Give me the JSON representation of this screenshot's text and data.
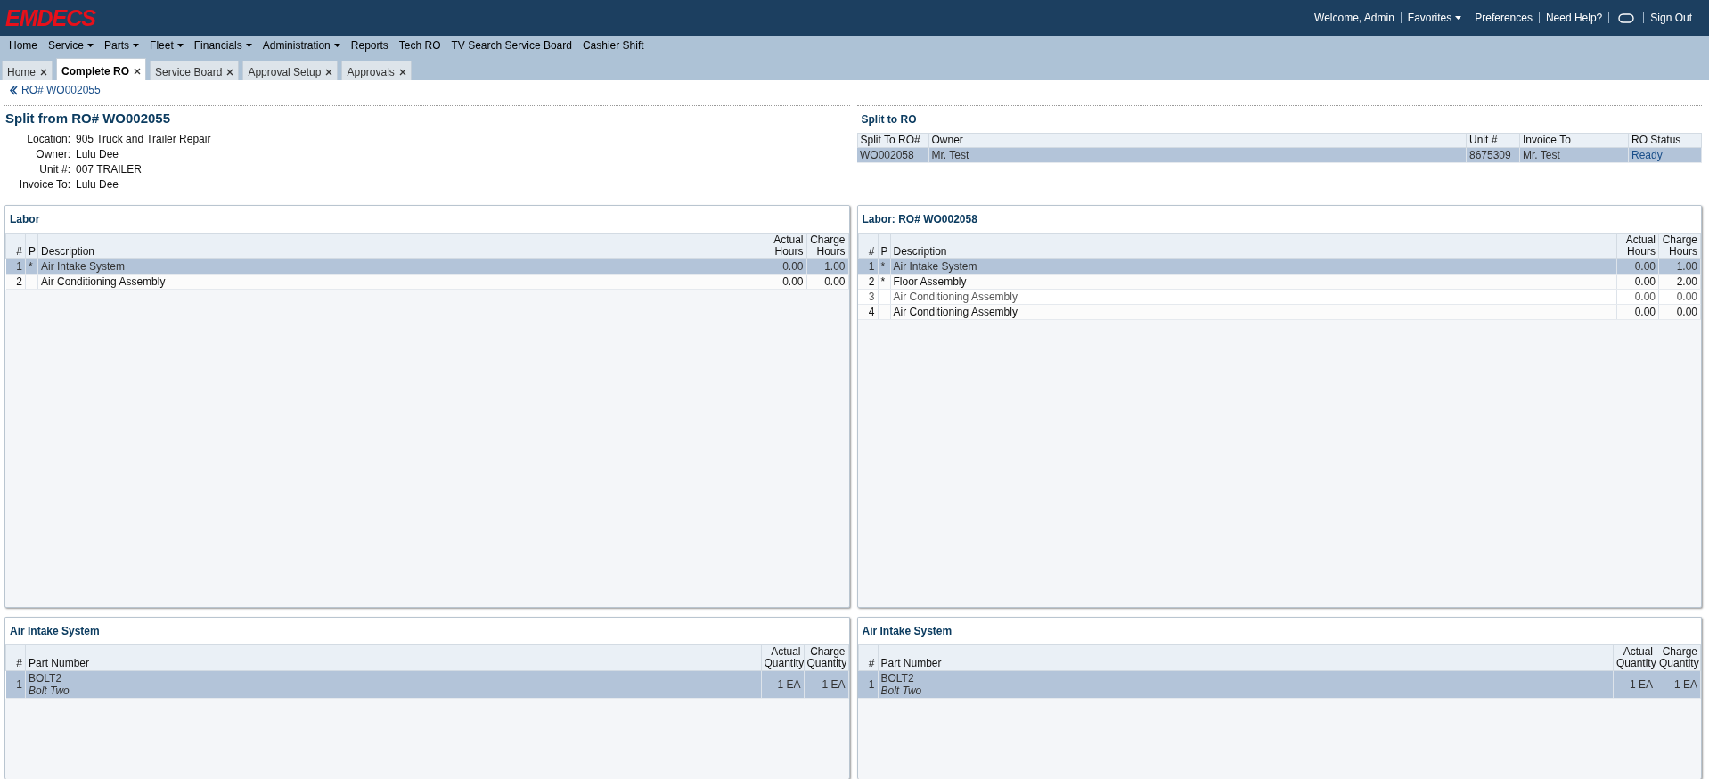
{
  "app_bar": {
    "logo": "EMDECS",
    "user_links": [
      {
        "kind": "text",
        "label": "Welcome, Admin"
      },
      {
        "kind": "menu",
        "label": "Favorites"
      },
      {
        "kind": "link",
        "label": "Preferences"
      },
      {
        "kind": "link",
        "label": "Need Help?"
      },
      {
        "kind": "chat"
      },
      {
        "kind": "link",
        "label": "Sign Out"
      }
    ]
  },
  "nav_menu": [
    {
      "label": "Home",
      "dropdown": false
    },
    {
      "label": "Service",
      "dropdown": true
    },
    {
      "label": "Parts",
      "dropdown": true
    },
    {
      "label": "Fleet",
      "dropdown": true
    },
    {
      "label": "Financials",
      "dropdown": true
    },
    {
      "label": "Administration",
      "dropdown": true
    },
    {
      "label": "Reports",
      "dropdown": false
    },
    {
      "label": "Tech RO",
      "dropdown": false
    },
    {
      "label": "TV Search Service Board",
      "dropdown": false
    },
    {
      "label": "Cashier Shift",
      "dropdown": false
    }
  ],
  "tabs": [
    {
      "label": "Home",
      "selected": false
    },
    {
      "label": "Complete RO",
      "selected": true
    },
    {
      "label": "Service Board",
      "selected": false
    },
    {
      "label": "Approval Setup",
      "selected": false
    },
    {
      "label": "Approvals",
      "selected": false
    }
  ],
  "breadcrumb": "RO# WO002055",
  "left": {
    "title": "Split from RO# WO002055",
    "fields": [
      {
        "label": "Location:",
        "value": "905 Truck and Trailer Repair"
      },
      {
        "label": "Owner:",
        "value": "Lulu Dee"
      },
      {
        "label": "Unit #:",
        "value": "007 TRAILER"
      },
      {
        "label": "Invoice To:",
        "value": "Lulu Dee"
      }
    ],
    "labor": {
      "title": "Labor",
      "columns": [
        "#",
        "P",
        "Description",
        "Actual Hours",
        "Charge Hours"
      ],
      "rows": [
        {
          "num": "1",
          "p": "*",
          "description": "Air Intake System",
          "actual": "0.00",
          "charge": "1.00",
          "selected": true,
          "dimmed": false
        },
        {
          "num": "2",
          "description": "Air Conditioning Assembly",
          "actual": "0.00",
          "charge": "0.00",
          "selected": false,
          "dimmed": false
        }
      ]
    },
    "parts": {
      "title": "Air Intake System",
      "columns": [
        "#",
        "Part Number",
        "Actual Quantity",
        "Charge Quantity"
      ],
      "rows": [
        {
          "num": "1",
          "part_number": "BOLT2",
          "description": "Bolt Two",
          "actual": "1 EA",
          "charge": "1 EA",
          "selected": true
        }
      ]
    }
  },
  "right": {
    "split_to": {
      "title": "Split to RO",
      "columns": [
        "Split To RO#",
        "Owner",
        "Unit #",
        "Invoice To",
        "RO Status"
      ],
      "rows": [
        {
          "ro": "WO002058",
          "owner": "Mr. Test",
          "unit": "8675309",
          "invoice_to": "Mr. Test",
          "status": "Ready",
          "selected": true
        }
      ]
    },
    "labor": {
      "title": "Labor: RO# WO002058",
      "columns": [
        "#",
        "P",
        "Description",
        "Actual Hours",
        "Charge Hours"
      ],
      "rows": [
        {
          "num": "1",
          "p": "*",
          "description": "Air Intake System",
          "actual": "0.00",
          "charge": "1.00",
          "selected": true,
          "dimmed": false
        },
        {
          "num": "2",
          "p": "*",
          "description": "Floor Assembly",
          "actual": "0.00",
          "charge": "2.00",
          "selected": false,
          "dimmed": false
        },
        {
          "num": "3",
          "description": "Air Conditioning Assembly",
          "actual": "0.00",
          "charge": "0.00",
          "selected": false,
          "dimmed": true
        },
        {
          "num": "4",
          "description": "Air Conditioning Assembly",
          "actual": "0.00",
          "charge": "0.00",
          "selected": false,
          "dimmed": false
        }
      ]
    },
    "parts": {
      "title": "Air Intake System",
      "columns": [
        "#",
        "Part Number",
        "Actual Quantity",
        "Charge Quantity"
      ],
      "rows": [
        {
          "num": "1",
          "part_number": "BOLT2",
          "description": "Bolt Two",
          "actual": "1 EA",
          "charge": "1 EA",
          "selected": true
        }
      ]
    }
  }
}
